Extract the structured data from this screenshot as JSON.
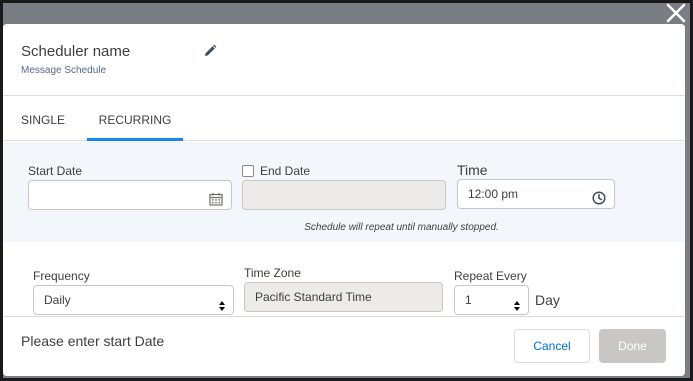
{
  "header": {
    "title": "Scheduler name",
    "subtitle": "Message Schedule"
  },
  "tabs": [
    {
      "label": "SINGLE"
    },
    {
      "label": "RECURRING",
      "active": true
    }
  ],
  "start_date": {
    "label": "Start Date",
    "value": ""
  },
  "end_date": {
    "label": "End Date",
    "checked": false,
    "value": ""
  },
  "time": {
    "label": "Time",
    "value": "12:00 pm"
  },
  "hint": "Schedule will repeat until manually stopped.",
  "frequency": {
    "label": "Frequency",
    "value": "Daily"
  },
  "timezone": {
    "label": "Time Zone",
    "value": "Pacific Standard Time"
  },
  "repeat_every": {
    "label": "Repeat Every",
    "value": "1",
    "unit": "Day"
  },
  "footer": {
    "status": "Please enter start Date",
    "cancel_label": "Cancel",
    "done_label": "Done"
  },
  "colors": {
    "accent": "#1589ee",
    "link": "#0070d2",
    "disabled_button": "#c9c7c5",
    "section_bg": "#f3f6fa"
  },
  "icons": [
    "close-icon",
    "pencil-icon",
    "calendar-icon",
    "clock-icon",
    "select-arrows-icon"
  ]
}
